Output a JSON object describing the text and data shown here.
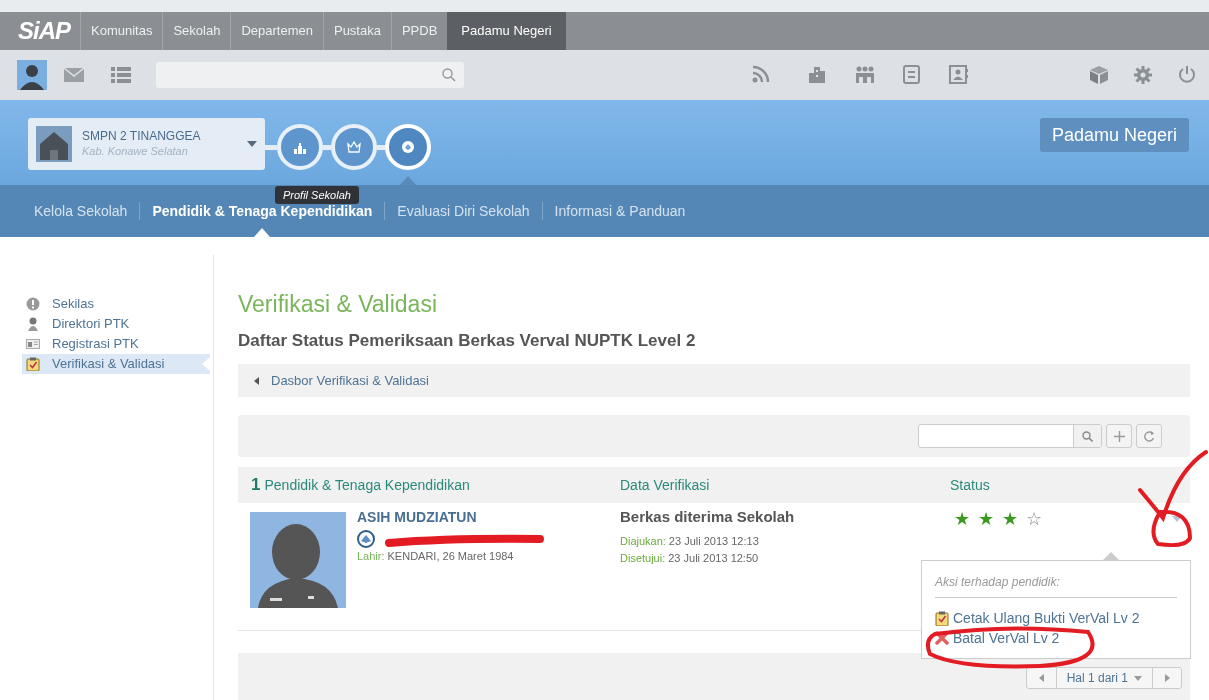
{
  "nav": {
    "logo": "SiAP",
    "items": [
      {
        "label": "Komunitas",
        "selected": false
      },
      {
        "label": "Sekolah",
        "selected": false
      },
      {
        "label": "Departemen",
        "selected": false
      },
      {
        "label": "Pustaka",
        "selected": false
      },
      {
        "label": "PPDB",
        "selected": false
      },
      {
        "label": "Padamu Negeri",
        "selected": true
      }
    ]
  },
  "school": {
    "name": "SMPN 2 TINANGGEA",
    "region": "Kab. Konawe Selatan"
  },
  "steps": [
    {
      "selected": false
    },
    {
      "selected": false
    },
    {
      "selected": true
    }
  ],
  "tooltip": "Profil Sekolah",
  "app_button": "Padamu Negeri",
  "subnav": [
    {
      "label": "Kelola Sekolah",
      "selected": false
    },
    {
      "label": "Pendidik & Tenaga Kependidikan",
      "selected": true
    },
    {
      "label": "Evaluasi Diri Sekolah",
      "selected": false
    },
    {
      "label": "Informasi & Panduan",
      "selected": false
    }
  ],
  "sidebar": [
    {
      "label": "Sekilas",
      "selected": false
    },
    {
      "label": "Direktori PTK",
      "selected": false
    },
    {
      "label": "Registrasi PTK",
      "selected": false
    },
    {
      "label": "Verifikasi & Validasi",
      "selected": true
    }
  ],
  "page": {
    "title": "Verifikasi & Validasi",
    "subtitle": "Daftar Status Pemeriksaan Berkas Verval NUPTK Level 2",
    "breadcrumb": "Dasbor Verifikasi & Validasi"
  },
  "table": {
    "count": "1",
    "columns": [
      "Pendidik & Tenaga Kependidikan",
      "Data Verifikasi",
      "Status"
    ],
    "rows": [
      {
        "name": "ASIH MUDZIATUN",
        "birth_label": "Lahir:",
        "birth": "KENDARI, 26 Maret 1984",
        "status": "Berkas diterima Sekolah",
        "submitted_label": "Diajukan:",
        "submitted": "23 Juli 2013 12:13",
        "approved_label": "Disetujui:",
        "approved": "23 Juli 2013 12:50",
        "stars": 3
      }
    ]
  },
  "menu": {
    "title": "Aksi terhadap pendidik:",
    "items": [
      "Cetak Ulang Bukti VerVal Lv 2",
      "Batal VerVal Lv 2"
    ]
  },
  "pager": "Hal 1 dari 1"
}
